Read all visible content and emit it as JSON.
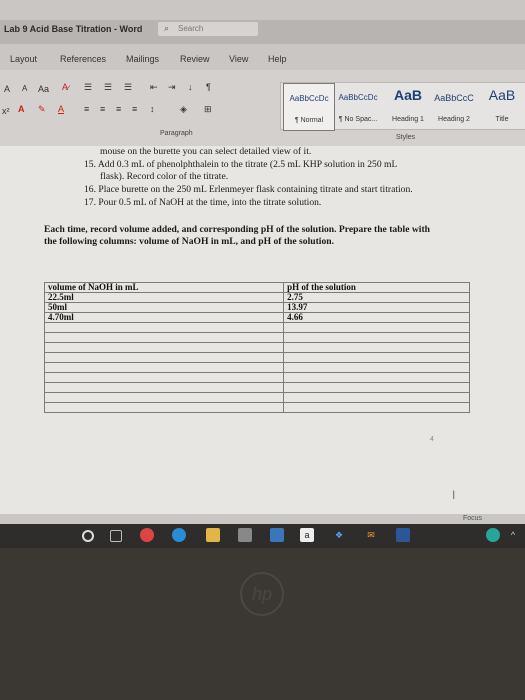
{
  "window": {
    "title": "Lab 9 Acid Base Titration - Word",
    "search_placeholder": "Search"
  },
  "tabs": [
    "Layout",
    "References",
    "Mailings",
    "Review",
    "View",
    "Help"
  ],
  "ribbon": {
    "font_grow": "A",
    "font_shrink": "A",
    "change_case": "Aa",
    "styles": [
      {
        "sample": "AaBbCcDc",
        "name": "¶ Normal"
      },
      {
        "sample": "AaBbCcDc",
        "name": "¶ No Spac..."
      },
      {
        "sample": "AaB",
        "name": "Heading 1"
      },
      {
        "sample": "AaBbCcC",
        "name": "Heading 2"
      },
      {
        "sample": "AaB",
        "name": "Title"
      }
    ],
    "group_paragraph": "Paragraph",
    "group_styles": "Styles"
  },
  "doc": {
    "line_cont": "mouse on the burette you can select detailed view of it.",
    "step15a": "15. Add 0.3 mL of phenolphthalein to the titrate (2.5 mL KHP solution in 250 mL",
    "step15b": "flask). Record color of the titrate.",
    "step16": "16. Place burette on the 250 mL Erlenmeyer flask containing titrate and start titration.",
    "step17": "17. Pour 0.5 mL of NaOH at the time, into the titrate solution.",
    "para1": "Each time, record volume added, and corresponding pH of the solution. Prepare the table with",
    "para2": "the following columns: volume of NaOH in mL, and pH of the solution."
  },
  "table": {
    "headers": [
      "volume of NaOH in mL",
      "pH of the solution"
    ],
    "rows": [
      [
        "22.5ml",
        "2.75"
      ],
      [
        "50ml",
        "13.97"
      ],
      [
        "4.70ml",
        "4.66"
      ],
      [
        "",
        ""
      ],
      [
        "",
        ""
      ],
      [
        "",
        ""
      ],
      [
        "",
        ""
      ],
      [
        "",
        ""
      ],
      [
        "",
        ""
      ],
      [
        "",
        ""
      ],
      [
        "",
        ""
      ],
      [
        "",
        ""
      ]
    ]
  },
  "status": {
    "page_num": "4",
    "focus": "Focus"
  },
  "taskbar": {
    "apps": [
      "start",
      "task-view",
      "chrome",
      "edge",
      "files",
      "store",
      "photos",
      "amazon",
      "dropbox",
      "mail",
      "word"
    ]
  }
}
